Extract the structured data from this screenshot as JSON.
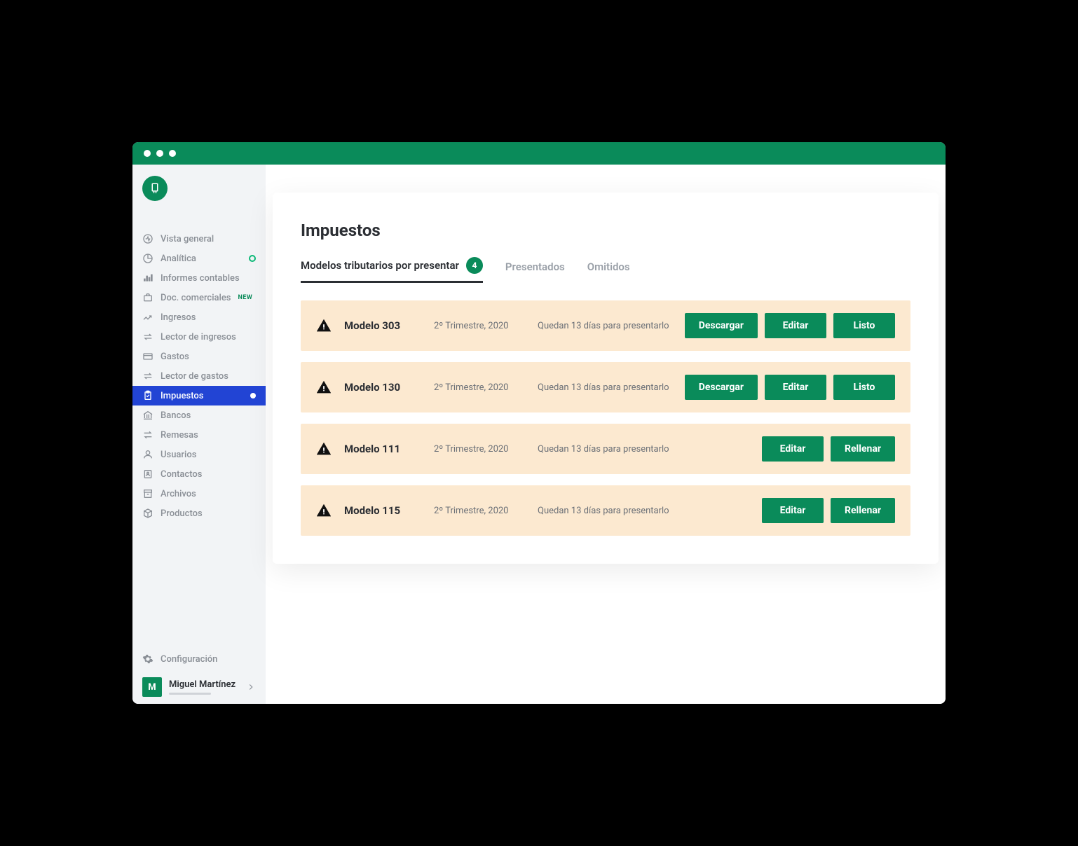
{
  "sidebar": {
    "items": [
      {
        "label": "Vista general",
        "icon": "activity"
      },
      {
        "label": "Analítica",
        "icon": "pie",
        "dot": true
      },
      {
        "label": "Informes contables",
        "icon": "bars"
      },
      {
        "label": "Doc. comerciales",
        "icon": "briefcase",
        "badge": "NEW"
      },
      {
        "label": "Ingresos",
        "icon": "trend"
      },
      {
        "label": "Lector de ingresos",
        "icon": "swap"
      },
      {
        "label": "Gastos",
        "icon": "card"
      },
      {
        "label": "Lector de gastos",
        "icon": "swap"
      },
      {
        "label": "Impuestos",
        "icon": "clipboard",
        "active": true
      },
      {
        "label": "Bancos",
        "icon": "bank"
      },
      {
        "label": "Remesas",
        "icon": "transfer"
      },
      {
        "label": "Usuarios",
        "icon": "user"
      },
      {
        "label": "Contactos",
        "icon": "contact"
      },
      {
        "label": "Archivos",
        "icon": "archive"
      },
      {
        "label": "Productos",
        "icon": "box"
      }
    ],
    "config_label": "Configuración",
    "user": {
      "initial": "M",
      "name": "Miguel Martínez"
    }
  },
  "page": {
    "title": "Impuestos",
    "tabs": [
      {
        "label": "Modelos tributarios por presentar",
        "count": "4",
        "active": true
      },
      {
        "label": "Presentados"
      },
      {
        "label": "Omitidos"
      }
    ],
    "rows": [
      {
        "name": "Modelo 303",
        "period": "2º Trimestre, 2020",
        "status": "Quedan 13 días para presentarlo",
        "actions": [
          "Descargar",
          "Editar",
          "Listo"
        ]
      },
      {
        "name": "Modelo 130",
        "period": "2º Trimestre, 2020",
        "status": "Quedan 13 días para presentarlo",
        "actions": [
          "Descargar",
          "Editar",
          "Listo"
        ]
      },
      {
        "name": "Modelo 111",
        "period": "2º Trimestre, 2020",
        "status": "Quedan 13 días para presentarlo",
        "actions": [
          "Editar",
          "Rellenar"
        ]
      },
      {
        "name": "Modelo 115",
        "period": "2º Trimestre, 2020",
        "status": "Quedan 13 días para presentarlo",
        "actions": [
          "Editar",
          "Rellenar"
        ]
      }
    ]
  }
}
